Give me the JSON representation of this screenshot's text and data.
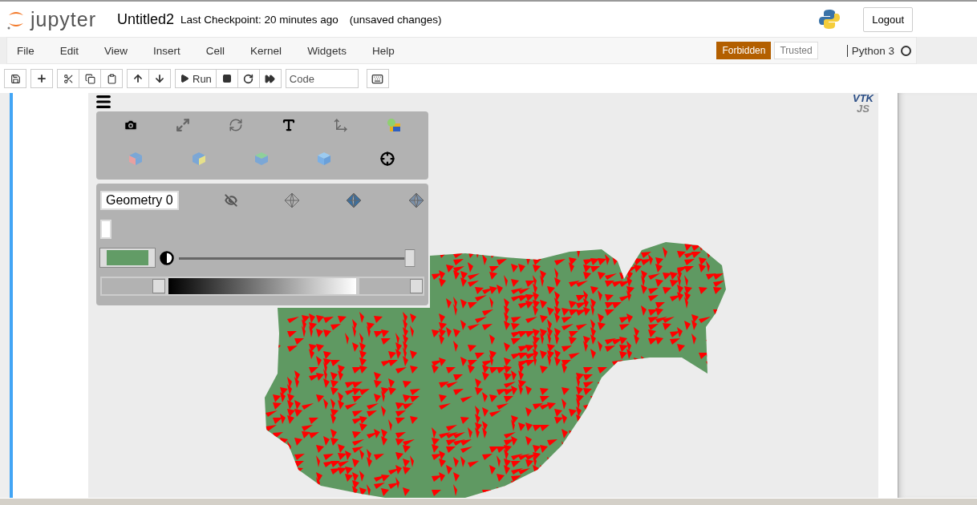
{
  "header": {
    "logo": "jupyter",
    "title": "Untitled2",
    "checkpoint": "Last Checkpoint: 20 minutes ago",
    "status": "(unsaved changes)",
    "logout": "Logout"
  },
  "menu": [
    "File",
    "Edit",
    "View",
    "Insert",
    "Cell",
    "Kernel",
    "Widgets",
    "Help"
  ],
  "badges": [
    {
      "label": "Forbidden",
      "kind": "notification"
    },
    {
      "label": "Trusted",
      "kind": "button"
    }
  ],
  "kernel": {
    "name": "Python 3",
    "busy": false
  },
  "toolbar": {
    "run": "Run",
    "cell_type": "Code"
  },
  "viewer": {
    "logo": [
      "VTK",
      "JS"
    ],
    "geometry": "Geometry 0",
    "opacity": {
      "level": 0.98
    }
  }
}
